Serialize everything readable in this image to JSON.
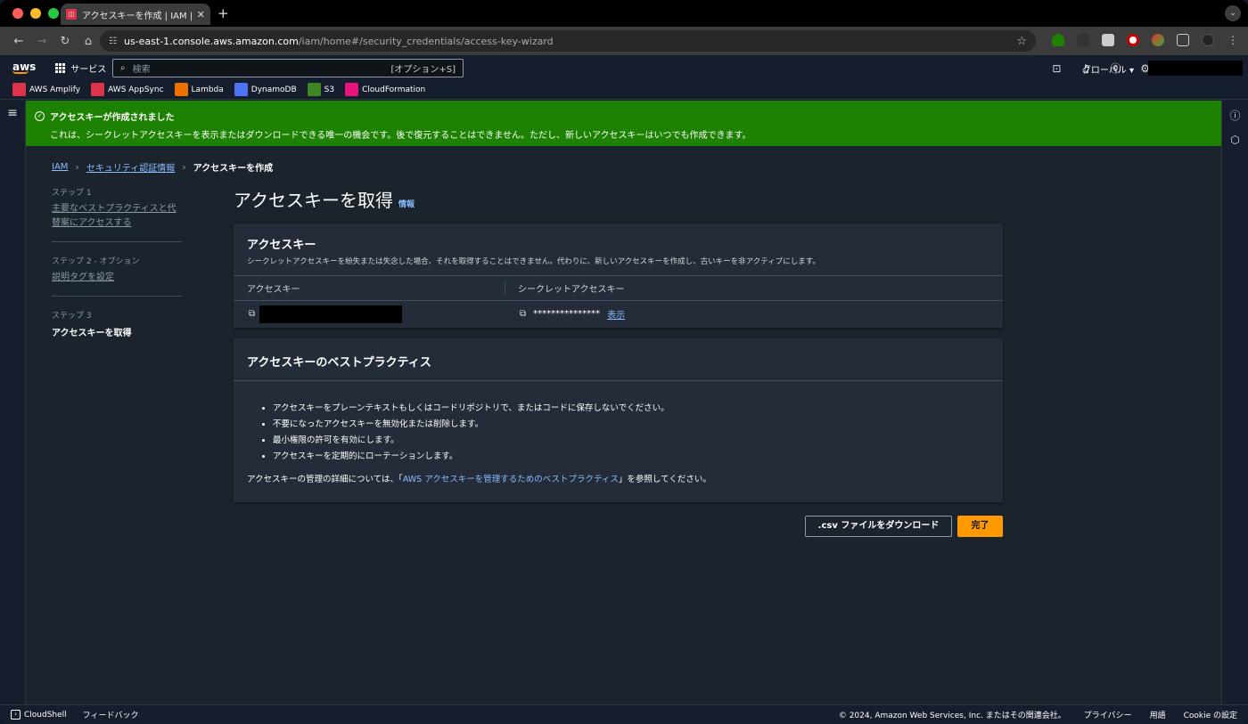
{
  "browser": {
    "tab_title": "アクセスキーを作成 | IAM | Global",
    "url_host": "us-east-1.console.aws.amazon.com",
    "url_path": "/iam/home#/security_credentials/access-key-wizard"
  },
  "aws_nav": {
    "logo": "aws",
    "services": "サービス",
    "search_placeholder": "検索",
    "search_shortcut": "[オプション+S]",
    "region": "グローバル ▾"
  },
  "favorites": [
    {
      "label": "AWS Amplify",
      "color": "#dd344c",
      "icon": "amplify-icon"
    },
    {
      "label": "AWS AppSync",
      "color": "#dd344c",
      "icon": "appsync-icon"
    },
    {
      "label": "Lambda",
      "color": "#ed7100",
      "icon": "lambda-icon"
    },
    {
      "label": "DynamoDB",
      "color": "#4d72f3",
      "icon": "dynamodb-icon"
    },
    {
      "label": "S3",
      "color": "#3f8624",
      "icon": "s3-icon"
    },
    {
      "label": "CloudFormation",
      "color": "#e7157b",
      "icon": "cloudformation-icon"
    }
  ],
  "flash": {
    "title": "アクセスキーが作成されました",
    "message": "これは、シークレットアクセスキーを表示またはダウンロードできる唯一の機会です。後で復元することはできません。ただし、新しいアクセスキーはいつでも作成できます。"
  },
  "breadcrumb": {
    "iam": "IAM",
    "security": "セキュリティ認証情報",
    "current": "アクセスキーを作成"
  },
  "steps": [
    {
      "num": "ステップ 1",
      "label": "主要なベストプラクティスと代替案にアクセスする"
    },
    {
      "num": "ステップ 2 - オプション",
      "label": "説明タグを設定"
    },
    {
      "num": "ステップ 3",
      "label": "アクセスキーを取得"
    }
  ],
  "page": {
    "title": "アクセスキーを取得",
    "info": "情報"
  },
  "access_key_panel": {
    "title": "アクセスキー",
    "desc": "シークレットアクセスキーを紛失または失念した場合、それを取得することはできません。代わりに、新しいアクセスキーを作成し、古いキーを非アクティブにします。",
    "col_access_key": "アクセスキー",
    "col_secret": "シークレットアクセスキー",
    "secret_masked": "***************",
    "show": "表示"
  },
  "best_practices": {
    "title": "アクセスキーのベストプラクティス",
    "items": [
      "アクセスキーをプレーンテキストもしくはコードリポジトリで、またはコードに保存しないでください。",
      "不要になったアクセスキーを無効化または削除します。",
      "最小権限の許可を有効にします。",
      "アクセスキーを定期的にローテーションします。"
    ],
    "footer_pre": "アクセスキーの管理の詳細については、「",
    "footer_link": "AWS アクセスキーを管理するためのベストプラクティス",
    "footer_post": "」を参照してください。"
  },
  "buttons": {
    "download_csv": ".csv ファイルをダウンロード",
    "done": "完了"
  },
  "footer": {
    "cloudshell": "CloudShell",
    "feedback": "フィードバック",
    "copyright": "© 2024, Amazon Web Services, Inc. またはその関連会社。",
    "privacy": "プライバシー",
    "terms": "用語",
    "cookie": "Cookie の設定"
  }
}
